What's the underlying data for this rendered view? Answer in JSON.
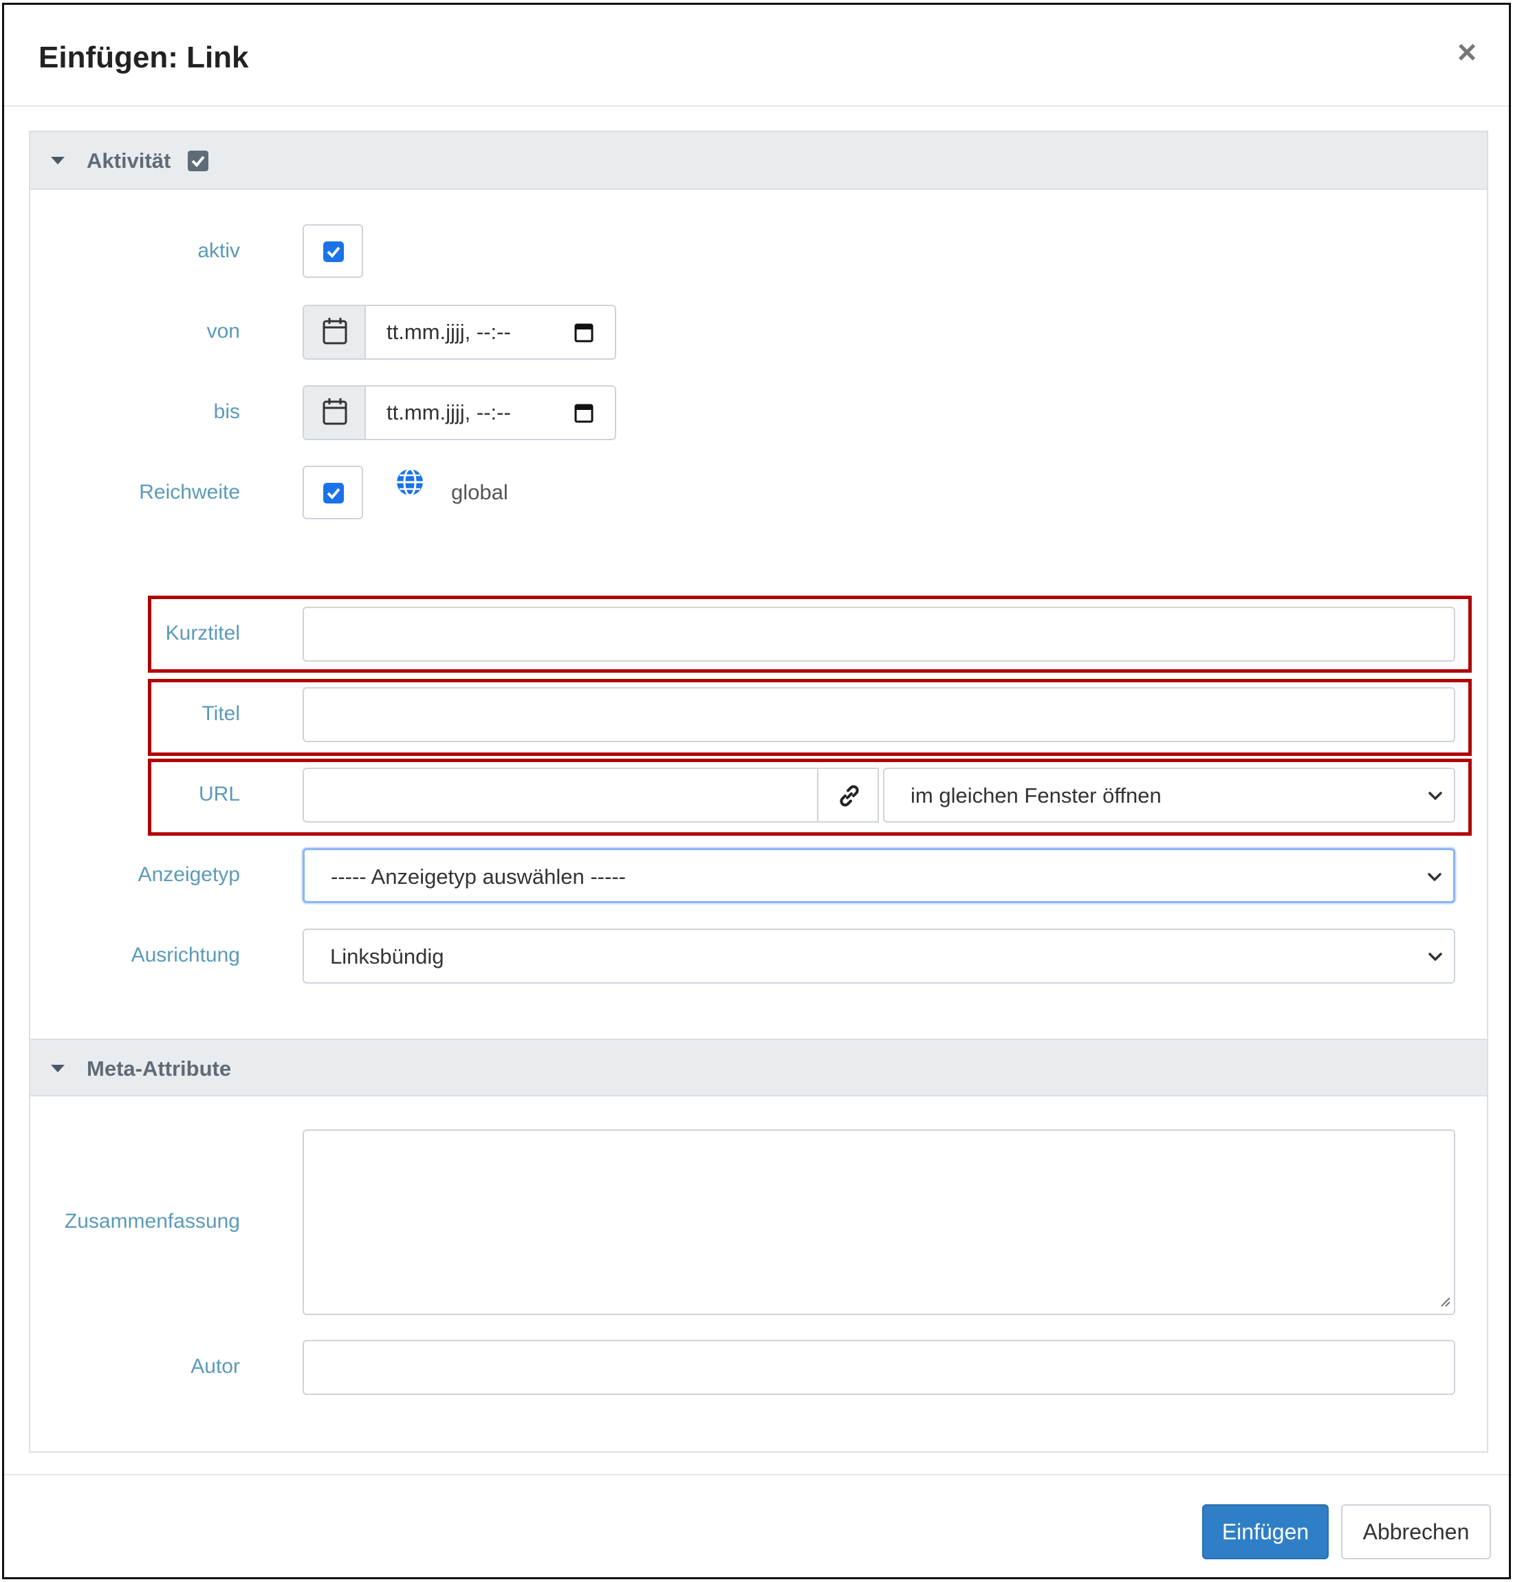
{
  "dialog": {
    "title": "Einfügen: Link",
    "close_label": "×"
  },
  "sections": {
    "activity": {
      "title": "Aktivität",
      "checked": true
    },
    "meta": {
      "title": "Meta-Attribute"
    }
  },
  "fields": {
    "aktiv": {
      "label": "aktiv",
      "checked": true
    },
    "von": {
      "label": "von",
      "value": "tt.mm.jjjj, --:--"
    },
    "bis": {
      "label": "bis",
      "value": "tt.mm.jjjj, --:--"
    },
    "reichweite": {
      "label": "Reichweite",
      "checked": true,
      "scope_text": "global",
      "icon": "globe-icon"
    },
    "kurztitel": {
      "label": "Kurztitel",
      "value": ""
    },
    "titel": {
      "label": "Titel",
      "value": ""
    },
    "url": {
      "label": "URL",
      "value": "",
      "icon": "link-icon",
      "target": "im gleichen Fenster öffnen"
    },
    "anzeigetyp": {
      "label": "Anzeigetyp",
      "value": "----- Anzeigetyp auswählen -----"
    },
    "ausrichtung": {
      "label": "Ausrichtung",
      "value": "Linksbündig"
    },
    "zusammenfassung": {
      "label": "Zusammenfassung",
      "value": ""
    },
    "autor": {
      "label": "Autor",
      "value": ""
    }
  },
  "buttons": {
    "insert": "Einfügen",
    "cancel": "Abbrechen"
  },
  "colors": {
    "label": "#5b9ab8",
    "primary": "#2f7fc6",
    "checkbox": "#1a73e8",
    "highlight": "#b00000",
    "section_bg": "#e9ecef"
  }
}
